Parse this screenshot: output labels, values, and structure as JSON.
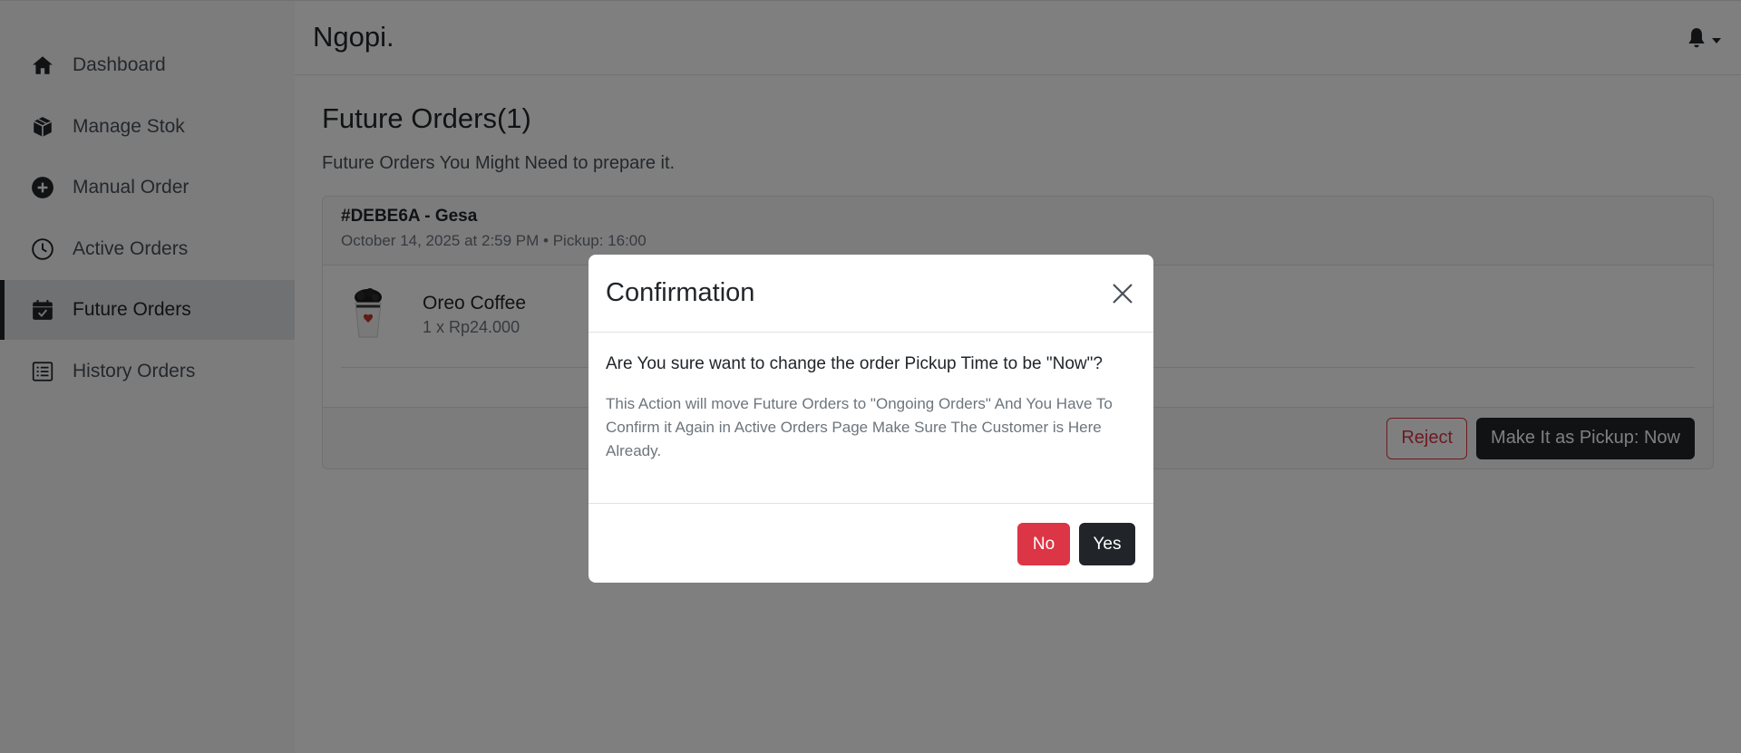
{
  "app": {
    "brand": "Ngopi."
  },
  "sidebar": {
    "items": [
      {
        "label": "Dashboard",
        "icon": "home-icon",
        "active": false
      },
      {
        "label": "Manage Stok",
        "icon": "box-icon",
        "active": false
      },
      {
        "label": "Manual Order",
        "icon": "plus-circle-icon",
        "active": false
      },
      {
        "label": "Active Orders",
        "icon": "clock-icon",
        "active": false
      },
      {
        "label": "Future Orders",
        "icon": "calendar-check-icon",
        "active": true
      },
      {
        "label": "History Orders",
        "icon": "list-icon",
        "active": false
      }
    ]
  },
  "header": {
    "notification_icon": "bell-icon"
  },
  "main": {
    "title": "Future Orders(1)",
    "subtitle": "Future Orders You Might Need to prepare it.",
    "order": {
      "id_customer": "#DEBE6A - Gesa",
      "meta": "October 14, 2025 at 2:59 PM • Pickup: 16:00",
      "items": [
        {
          "name": "Oreo Coffee",
          "qty_price": "1 x Rp24.000",
          "image": "coffee-cup-image"
        }
      ],
      "reject_label": "Reject",
      "pickup_now_label": "Make It as Pickup: Now"
    }
  },
  "modal": {
    "title": "Confirmation",
    "question": "Are You sure want to change the order Pickup Time to be \"Now\"?",
    "detail": "This Action will move Future Orders to \"Ongoing Orders\" And You Have To Confirm it Again in Active Orders Page Make Sure The Customer is Here Already.",
    "no_label": "No",
    "yes_label": "Yes"
  },
  "colors": {
    "dark": "#212529",
    "danger": "#dc3545",
    "muted": "#6c757d",
    "backdrop": "rgba(0,0,0,0.5)"
  }
}
